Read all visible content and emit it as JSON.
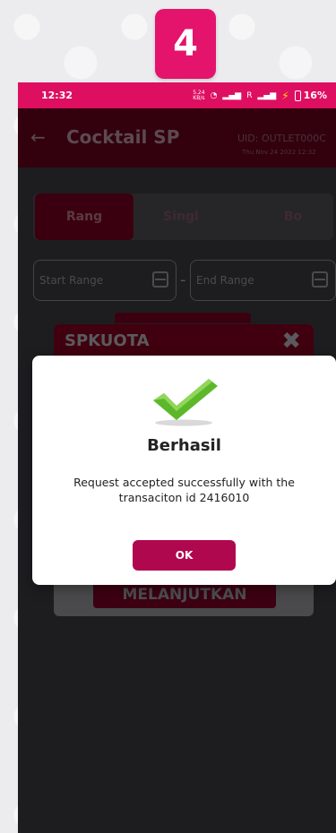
{
  "badge": {
    "step": "4"
  },
  "status_bar": {
    "time": "12:32",
    "net_speed_top": "5.24",
    "net_speed_unit": "KB/s",
    "signal_text": "R",
    "battery": "16%"
  },
  "appbar": {
    "title": "Cocktail SP",
    "uid": "UID: OUTLET000C",
    "date": "Thu Nov 24 2022 12:32"
  },
  "tabs": [
    {
      "label": "Rang",
      "active": true
    },
    {
      "label": "Singl",
      "active": false
    },
    {
      "label": "Bo",
      "active": false
    }
  ],
  "range": {
    "start_placeholder": "Start Range",
    "separator": "-",
    "end_placeholder": "End Range"
  },
  "sheet": {
    "title": "SPKUOTA",
    "close_glyph": "✖",
    "continue_label": "MELANJUTKAN"
  },
  "dialog": {
    "title": "Berhasil",
    "message": "Request accepted successfully with the transaciton id 2416010",
    "ok_label": "OK"
  },
  "colors": {
    "brand_pink": "#e4146c",
    "ok_button": "#b0084f",
    "check_green": "#5cb82a"
  }
}
